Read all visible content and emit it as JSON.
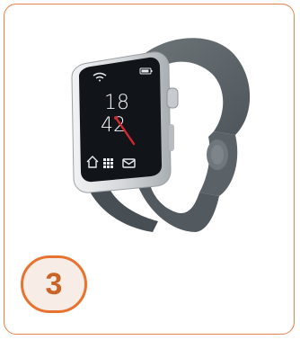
{
  "watch": {
    "hour": "18",
    "minute": "42"
  },
  "badge": {
    "number": "3"
  },
  "colors": {
    "card_border": "#e3824a",
    "badge_border": "#e8722f",
    "badge_fill": "#f7ede6",
    "badge_text": "#c96426",
    "strap": "#5d6469",
    "case": "#d9dcdf",
    "screen": "#111418",
    "hand": "#d8262e"
  },
  "icons": [
    "wifi-icon",
    "battery-icon",
    "home-icon",
    "apps-grid-icon",
    "mail-icon"
  ]
}
